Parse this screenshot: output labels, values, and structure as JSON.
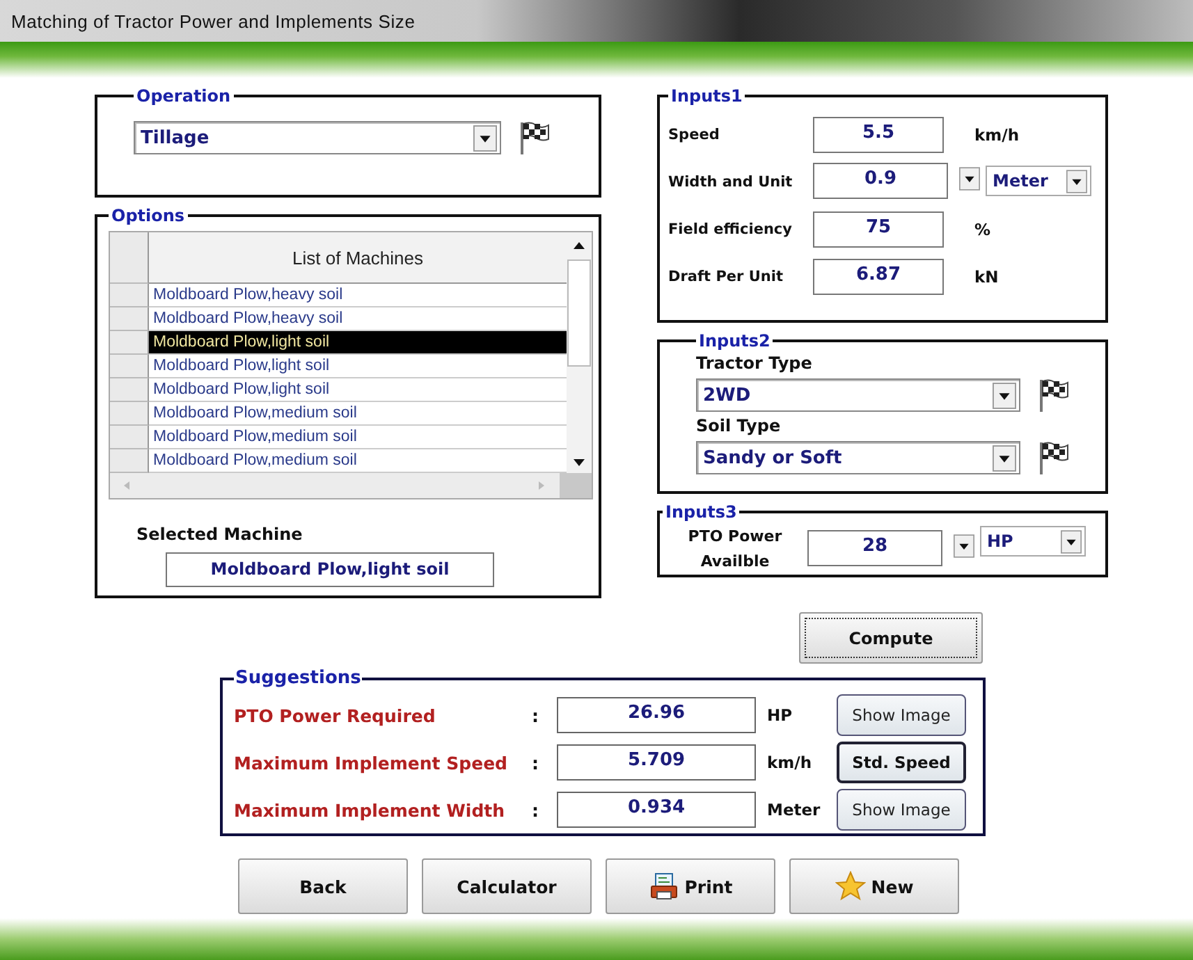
{
  "window": {
    "title": "Matching of Tractor Power and  Implements Size"
  },
  "operation": {
    "label": "Operation",
    "value": "Tillage"
  },
  "options": {
    "label": "Options",
    "column": "List of Machines",
    "machines": [
      {
        "name": "Moldboard Plow,heavy soil",
        "selected": false
      },
      {
        "name": "Moldboard Plow,heavy soil",
        "selected": false
      },
      {
        "name": "Moldboard Plow,light soil",
        "selected": true
      },
      {
        "name": "Moldboard Plow,light soil",
        "selected": false
      },
      {
        "name": "Moldboard Plow,light soil",
        "selected": false
      },
      {
        "name": "Moldboard Plow,medium soil",
        "selected": false
      },
      {
        "name": "Moldboard Plow,medium soil",
        "selected": false
      },
      {
        "name": "Moldboard Plow,medium soil",
        "selected": false
      }
    ],
    "selected_label": "Selected Machine",
    "selected_value": "Moldboard Plow,light soil"
  },
  "inputs1": {
    "label": "Inputs1",
    "rows": [
      {
        "kind": "field",
        "label": "Speed",
        "value": "5.5",
        "unit": "km/h"
      },
      {
        "kind": "combo",
        "label": "Width and Unit",
        "value": "0.9",
        "unit": "Meter"
      },
      {
        "kind": "field",
        "label": "Field efficiency",
        "value": "75",
        "unit": "%"
      },
      {
        "kind": "field",
        "label": "Draft Per Unit",
        "value": "6.87",
        "unit": "kN"
      }
    ]
  },
  "inputs2": {
    "label": "Inputs2",
    "selects": [
      {
        "label": "Tractor Type",
        "value": "2WD"
      },
      {
        "label": "Soil Type",
        "value": "Sandy or Soft"
      }
    ]
  },
  "inputs3": {
    "label": "Inputs3",
    "field_label": "PTO Power Availble",
    "value": "28",
    "unit": "HP"
  },
  "compute": "Compute",
  "suggestions": {
    "label": "Suggestions",
    "rows": [
      {
        "label": "PTO Power Required",
        "colon": ":",
        "value": "26.96",
        "unit": "HP",
        "button": "Show Image",
        "default": false
      },
      {
        "label": "Maximum Implement Speed",
        "colon": ":",
        "value": "5.709",
        "unit": "km/h",
        "button": "Std. Speed",
        "default": true
      },
      {
        "label": "Maximum Implement Width",
        "colon": ":",
        "value": "0.934",
        "unit": "Meter",
        "button": "Show Image",
        "default": false
      }
    ]
  },
  "buttons": [
    {
      "label": "Back",
      "kind": "plain"
    },
    {
      "label": "Calculator",
      "kind": "plain"
    },
    {
      "label": "Print",
      "kind": "print"
    },
    {
      "label": "New",
      "kind": "star"
    }
  ]
}
